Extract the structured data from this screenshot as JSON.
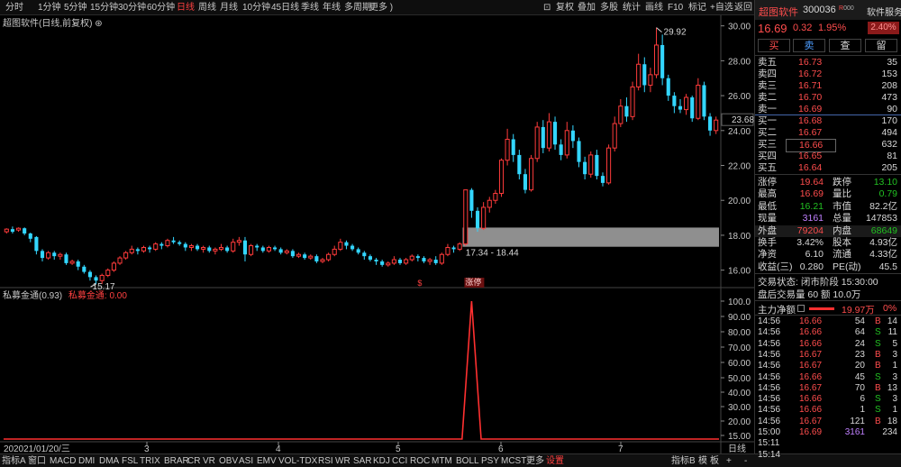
{
  "toolbar": {
    "periods": [
      "分时",
      "1分钟",
      "5分钟",
      "15分钟",
      "30分钟",
      "60分钟",
      "日线",
      "周线",
      "月线",
      "10分钟",
      "45日线",
      "季线",
      "年线",
      "多周期",
      "更多"
    ],
    "active_period": "日线",
    "right_buttons": [
      "复权",
      "叠加",
      "多股",
      "统计",
      "画线",
      "F10",
      "标记",
      "+自选",
      "返回"
    ]
  },
  "chart": {
    "title": "超图软件(日线,前复权)",
    "price_axis": [
      "30.00",
      "28.00",
      "26.00",
      "24.00",
      "22.00",
      "20.00",
      "18.00",
      "16.00"
    ],
    "current_price_label": "23.68",
    "high_label": "29.92",
    "low_label": "15.17",
    "range_label": "17.34 - 18.44",
    "event_marker": "涨停",
    "marker_s": "$"
  },
  "indicator": {
    "title": "私募金通(0.93)",
    "value_label": "私募金通: 0.00",
    "axis": [
      "100.0",
      "90.00",
      "80.00",
      "70.00",
      "60.00",
      "50.00",
      "40.00",
      "30.00",
      "20.00",
      "15.00"
    ]
  },
  "date_axis": {
    "first_prefix": "20",
    "first_date": "2021/01/20/三",
    "labels": [
      "3",
      "4",
      "5",
      "6",
      "7"
    ],
    "right_label": "日线"
  },
  "bottom_tabs": {
    "left": [
      "指标A",
      "窗口",
      "MACD",
      "DMI",
      "DMA",
      "FSL",
      "TRIX",
      "BRAR",
      "CR",
      "VR",
      "OBV",
      "ASI",
      "EMV",
      "VOL-TDX",
      "RSI",
      "WR",
      "SAR",
      "KDJ",
      "CCI",
      "ROC",
      "MTM",
      "BOLL",
      "PSY",
      "MCST",
      "更多",
      "设置"
    ],
    "active": "设置",
    "right": [
      "指标B",
      "模",
      "板",
      "+",
      "-"
    ]
  },
  "stock": {
    "name": "超图软件",
    "code": "300036",
    "badge": "R",
    "badge2": "000",
    "service": "软件服务",
    "price": "16.69",
    "change": "0.32",
    "change_pct": "1.95%",
    "sector_pct": "2.40%",
    "trade_buttons": [
      "买",
      "卖",
      "查",
      "留"
    ]
  },
  "order_book": {
    "asks": [
      {
        "label": "卖五",
        "price": "16.73",
        "vol": "35"
      },
      {
        "label": "卖四",
        "price": "16.72",
        "vol": "153"
      },
      {
        "label": "卖三",
        "price": "16.71",
        "vol": "208"
      },
      {
        "label": "卖二",
        "price": "16.70",
        "vol": "473"
      },
      {
        "label": "卖一",
        "price": "16.69",
        "vol": "90"
      }
    ],
    "bids": [
      {
        "label": "买一",
        "price": "16.68",
        "vol": "170"
      },
      {
        "label": "买二",
        "price": "16.67",
        "vol": "494"
      },
      {
        "label": "买三",
        "price": "16.66",
        "vol": "632"
      },
      {
        "label": "买四",
        "price": "16.65",
        "vol": "81"
      },
      {
        "label": "买五",
        "price": "16.64",
        "vol": "205"
      }
    ]
  },
  "stats": [
    {
      "l1": "涨停",
      "v1": "19.64",
      "c1": "red",
      "l2": "跌停",
      "v2": "13.10",
      "c2": "green"
    },
    {
      "l1": "最高",
      "v1": "16.69",
      "c1": "red",
      "l2": "量比",
      "v2": "0.79",
      "c2": "green"
    },
    {
      "l1": "最低",
      "v1": "16.21",
      "c1": "green",
      "l2": "市值",
      "v2": "82.2亿",
      "c2": "white"
    },
    {
      "l1": "现量",
      "v1": "3161",
      "c1": "purple",
      "l2": "总量",
      "v2": "147853",
      "c2": "white"
    },
    {
      "l1": "外盘",
      "v1": "79204",
      "c1": "red",
      "l2": "内盘",
      "v2": "68649",
      "c2": "green"
    },
    {
      "l1": "换手",
      "v1": "3.42%",
      "c1": "white",
      "l2": "股本",
      "v2": "4.93亿",
      "c2": "white"
    },
    {
      "l1": "净资",
      "v1": "6.10",
      "c1": "white",
      "l2": "流通",
      "v2": "4.33亿",
      "c2": "white"
    },
    {
      "l1": "收益(三)",
      "v1": "0.280",
      "c1": "white",
      "l2": "PE(动)",
      "v2": "45.5",
      "c2": "white"
    }
  ],
  "trade_status": "交易状态: 闭市阶段 15:30:00",
  "after_hours": "盘后交易量 60 额 10.0万",
  "main_flow": {
    "label": "主力净额",
    "value": "19.97万",
    "pct": "0%"
  },
  "ticks": [
    {
      "time": "14:56",
      "price": "16.66",
      "vol": "54",
      "bs": "B",
      "n": "14"
    },
    {
      "time": "14:56",
      "price": "16.66",
      "vol": "64",
      "bs": "S",
      "n": "11"
    },
    {
      "time": "14:56",
      "price": "16.66",
      "vol": "24",
      "bs": "S",
      "n": "5"
    },
    {
      "time": "14:56",
      "price": "16.67",
      "vol": "23",
      "bs": "B",
      "n": "3"
    },
    {
      "time": "14:56",
      "price": "16.67",
      "vol": "20",
      "bs": "B",
      "n": "1"
    },
    {
      "time": "14:56",
      "price": "16.66",
      "vol": "45",
      "bs": "S",
      "n": "3"
    },
    {
      "time": "14:56",
      "price": "16.67",
      "vol": "70",
      "bs": "B",
      "n": "13"
    },
    {
      "time": "14:56",
      "price": "16.66",
      "vol": "6",
      "bs": "S",
      "n": "3"
    },
    {
      "time": "14:56",
      "price": "16.66",
      "vol": "1",
      "bs": "S",
      "n": "1"
    },
    {
      "time": "14:56",
      "price": "16.67",
      "vol": "121",
      "bs": "B",
      "n": "18"
    },
    {
      "time": "15:00",
      "price": "16.69",
      "vol": "3161",
      "bs": "",
      "n": "234"
    },
    {
      "time": "15:11",
      "price": "",
      "vol": "",
      "bs": "",
      "n": ""
    },
    {
      "time": "15:14",
      "price": "",
      "vol": "",
      "bs": "",
      "n": ""
    }
  ],
  "chart_data": {
    "type": "candlestick",
    "price_axis": {
      "min": 15.0,
      "max": 30.5,
      "ticks": [
        30,
        28,
        26,
        24,
        22,
        20,
        18,
        16
      ]
    },
    "candles": [
      [
        18.2,
        18.35,
        18.4,
        18.1
      ],
      [
        18.35,
        18.2,
        18.5,
        18.1
      ],
      [
        18.3,
        18.4,
        18.45,
        18.2
      ],
      [
        18.4,
        18.1,
        18.45,
        18.0
      ],
      [
        18.1,
        17.8,
        18.15,
        17.6
      ],
      [
        17.9,
        17.1,
        17.95,
        16.9
      ],
      [
        17.1,
        16.7,
        17.2,
        16.5
      ],
      [
        16.7,
        17.0,
        17.1,
        16.6
      ],
      [
        17.0,
        16.8,
        17.1,
        16.6
      ],
      [
        16.8,
        16.9,
        17.0,
        16.6
      ],
      [
        16.9,
        16.4,
        17.0,
        16.3
      ],
      [
        16.4,
        16.5,
        16.6,
        16.3
      ],
      [
        16.5,
        16.2,
        16.6,
        16.0
      ],
      [
        16.2,
        15.9,
        16.3,
        15.8
      ],
      [
        15.9,
        15.6,
        16.0,
        15.4
      ],
      [
        15.6,
        15.4,
        15.7,
        15.2
      ],
      [
        15.4,
        15.7,
        15.8,
        15.2
      ],
      [
        15.7,
        16.0,
        16.1,
        15.6
      ],
      [
        16.0,
        16.4,
        16.5,
        15.9
      ],
      [
        16.4,
        16.7,
        16.8,
        16.3
      ],
      [
        16.7,
        17.0,
        17.1,
        16.6
      ],
      [
        17.0,
        17.2,
        17.4,
        16.9
      ],
      [
        17.2,
        17.1,
        17.3,
        16.9
      ],
      [
        17.1,
        17.3,
        17.4,
        17.0
      ],
      [
        17.3,
        17.2,
        17.4,
        17.0
      ],
      [
        17.2,
        17.5,
        17.6,
        17.1
      ],
      [
        17.5,
        17.4,
        17.6,
        17.2
      ],
      [
        17.4,
        17.7,
        17.8,
        17.3
      ],
      [
        17.7,
        17.6,
        17.9,
        17.5
      ],
      [
        17.6,
        17.5,
        17.7,
        17.4
      ],
      [
        17.5,
        17.3,
        17.6,
        17.1
      ],
      [
        17.3,
        17.4,
        17.5,
        17.1
      ],
      [
        17.4,
        17.2,
        17.5,
        17.1
      ],
      [
        17.2,
        17.3,
        17.4,
        17.0
      ],
      [
        17.3,
        17.1,
        17.4,
        17.0
      ],
      [
        17.1,
        17.2,
        17.3,
        16.9
      ],
      [
        17.2,
        17.3,
        17.5,
        17.1
      ],
      [
        17.3,
        17.1,
        17.4,
        17.0
      ],
      [
        17.1,
        17.6,
        17.8,
        17.0
      ],
      [
        17.6,
        17.7,
        17.9,
        17.4
      ],
      [
        17.7,
        16.9,
        17.9,
        16.5
      ],
      [
        16.9,
        17.4,
        17.5,
        16.8
      ],
      [
        17.4,
        17.3,
        17.5,
        17.1
      ],
      [
        17.3,
        17.1,
        17.4,
        17.0
      ],
      [
        17.1,
        17.3,
        17.4,
        17.0
      ],
      [
        17.3,
        17.2,
        17.4,
        17.1
      ],
      [
        17.2,
        17.0,
        17.3,
        16.9
      ],
      [
        17.0,
        17.1,
        17.2,
        16.9
      ],
      [
        17.1,
        16.8,
        17.2,
        16.7
      ],
      [
        16.8,
        16.9,
        17.0,
        16.7
      ],
      [
        16.9,
        16.7,
        17.0,
        16.6
      ],
      [
        16.7,
        16.8,
        16.9,
        16.6
      ],
      [
        16.8,
        16.5,
        16.9,
        16.4
      ],
      [
        16.5,
        16.6,
        16.7,
        16.4
      ],
      [
        16.6,
        16.9,
        17.0,
        16.5
      ],
      [
        16.9,
        17.2,
        17.4,
        16.8
      ],
      [
        17.2,
        17.6,
        17.8,
        17.1
      ],
      [
        17.6,
        17.4,
        17.7,
        17.2
      ],
      [
        17.4,
        17.2,
        17.5,
        17.1
      ],
      [
        17.2,
        17.0,
        17.3,
        16.9
      ],
      [
        17.0,
        16.8,
        17.1,
        16.6
      ],
      [
        16.8,
        16.6,
        16.9,
        16.5
      ],
      [
        16.6,
        16.5,
        16.7,
        16.3
      ],
      [
        16.5,
        16.3,
        16.6,
        16.2
      ],
      [
        16.3,
        16.4,
        16.5,
        16.2
      ],
      [
        16.4,
        16.6,
        16.8,
        16.3
      ],
      [
        16.6,
        16.4,
        16.7,
        16.3
      ],
      [
        16.4,
        16.6,
        16.7,
        16.3
      ],
      [
        16.6,
        16.8,
        16.9,
        16.5
      ],
      [
        16.8,
        16.7,
        16.9,
        16.5
      ],
      [
        16.7,
        16.5,
        16.8,
        16.4
      ],
      [
        16.5,
        16.6,
        16.7,
        16.3
      ],
      [
        16.6,
        16.4,
        16.8,
        16.3
      ],
      [
        16.4,
        16.9,
        17.0,
        16.3
      ],
      [
        16.9,
        17.3,
        17.5,
        16.8
      ],
      [
        17.3,
        17.2,
        17.4,
        17.0
      ],
      [
        17.2,
        17.5,
        17.6,
        17.1
      ],
      [
        17.5,
        20.6,
        20.6,
        17.4
      ],
      [
        20.6,
        19.4,
        20.7,
        19.0
      ],
      [
        19.4,
        18.4,
        19.6,
        18.2
      ],
      [
        18.4,
        19.6,
        19.9,
        18.3
      ],
      [
        19.6,
        20.0,
        20.2,
        19.3
      ],
      [
        20.0,
        20.4,
        20.6,
        19.8
      ],
      [
        20.4,
        22.3,
        22.4,
        20.2
      ],
      [
        22.3,
        23.5,
        24.1,
        22.0
      ],
      [
        23.5,
        22.6,
        23.8,
        22.2
      ],
      [
        22.6,
        21.5,
        22.9,
        21.2
      ],
      [
        21.5,
        20.6,
        21.8,
        20.4
      ],
      [
        20.6,
        22.4,
        22.6,
        20.5
      ],
      [
        22.4,
        24.2,
        24.5,
        22.2
      ],
      [
        24.2,
        23.0,
        24.6,
        22.7
      ],
      [
        23.0,
        24.5,
        25.0,
        22.8
      ],
      [
        24.5,
        23.2,
        24.8,
        22.9
      ],
      [
        23.2,
        22.6,
        23.5,
        22.3
      ],
      [
        22.6,
        24.0,
        24.5,
        22.4
      ],
      [
        24.0,
        23.4,
        24.3,
        23.0
      ],
      [
        23.4,
        22.2,
        23.6,
        21.9
      ],
      [
        22.2,
        21.5,
        22.5,
        21.2
      ],
      [
        21.5,
        22.6,
        22.8,
        21.3
      ],
      [
        22.6,
        21.4,
        22.9,
        21.2
      ],
      [
        21.4,
        21.0,
        21.6,
        20.8
      ],
      [
        21.0,
        23.0,
        23.2,
        20.9
      ],
      [
        23.0,
        24.4,
        24.8,
        22.8
      ],
      [
        24.4,
        25.4,
        25.8,
        24.2
      ],
      [
        25.4,
        24.8,
        25.9,
        24.5
      ],
      [
        24.8,
        26.5,
        26.8,
        24.6
      ],
      [
        26.5,
        27.8,
        28.4,
        26.3
      ],
      [
        27.8,
        26.6,
        28.2,
        26.2
      ],
      [
        26.6,
        27.2,
        27.6,
        26.2
      ],
      [
        27.2,
        28.9,
        29.9,
        27.0
      ],
      [
        28.9,
        27.0,
        29.5,
        26.6
      ],
      [
        27.0,
        26.0,
        27.2,
        25.7
      ],
      [
        26.0,
        25.4,
        26.2,
        25.0
      ],
      [
        25.4,
        25.2,
        25.8,
        25.0
      ],
      [
        25.2,
        25.9,
        26.1,
        24.9
      ],
      [
        25.9,
        24.7,
        26.0,
        24.5
      ],
      [
        24.7,
        26.6,
        27.0,
        24.6
      ],
      [
        26.6,
        24.8,
        26.8,
        24.6
      ],
      [
        24.8,
        24.0,
        25.0,
        23.7
      ],
      [
        24.0,
        24.6,
        24.8,
        23.8
      ]
    ],
    "highlight_range": [
      17.34,
      18.44
    ],
    "indicator_series": {
      "name": "私募金通",
      "spike_index": 78,
      "spike_value": 100
    }
  }
}
